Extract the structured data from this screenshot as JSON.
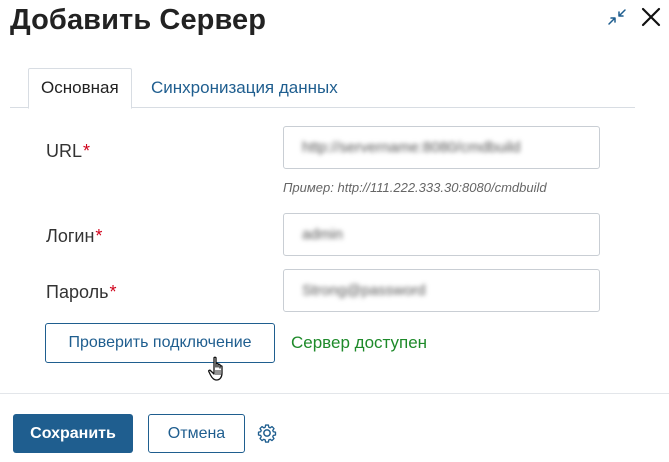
{
  "dialog": {
    "title": "Добавить Сервер"
  },
  "tabs": [
    {
      "label": "Основная",
      "active": true
    },
    {
      "label": "Синхронизация данных",
      "active": false
    }
  ],
  "form": {
    "url": {
      "label": "URL",
      "required_mark": "*",
      "value": "http://servername:8080/cmdbuild",
      "hint": "Пример: http://111.222.333.30:8080/cmdbuild"
    },
    "login": {
      "label": "Логин",
      "required_mark": "*",
      "value": "admin"
    },
    "password": {
      "label": "Пароль",
      "required_mark": "*",
      "value": "Strong@password"
    }
  },
  "connection": {
    "check_label": "Проверить подключение",
    "status": "Сервер доступен",
    "status_color": "#1e8a2a"
  },
  "footer": {
    "save_label": "Сохранить",
    "cancel_label": "Отмена"
  },
  "colors": {
    "accent": "#1f5e8f",
    "required": "#d0021b"
  },
  "icons": {
    "collapse": "collapse-icon",
    "close": "close-icon",
    "pointer": "hand-pointer-icon",
    "settings": "gear-icon"
  }
}
